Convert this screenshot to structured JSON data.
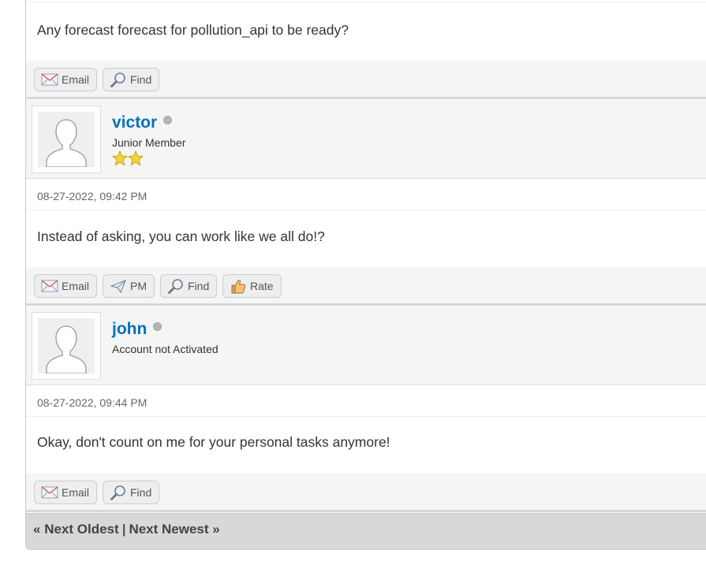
{
  "posts": [
    {
      "text": "Any forecast forecast for pollution_api to be ready?",
      "buttons": [
        {
          "label": "Email",
          "icon": "email-icon"
        },
        {
          "label": "Find",
          "icon": "magnifier-icon"
        }
      ]
    },
    {
      "username": "victor",
      "user_title": "Junior Member",
      "stars": 2,
      "date": "08-27-2022, 09:42 PM",
      "text": "Instead of asking, you can work like we all do!?",
      "buttons": [
        {
          "label": "Email",
          "icon": "email-icon"
        },
        {
          "label": "PM",
          "icon": "paper-plane-icon"
        },
        {
          "label": "Find",
          "icon": "magnifier-icon"
        },
        {
          "label": "Rate",
          "icon": "thumbs-up-icon"
        }
      ]
    },
    {
      "username": "john",
      "user_title": "Account not Activated",
      "date": "08-27-2022, 09:44 PM",
      "text": "Okay, don't count on me for your personal tasks anymore!",
      "buttons": [
        {
          "label": "Email",
          "icon": "email-icon"
        },
        {
          "label": "Find",
          "icon": "magnifier-icon"
        }
      ]
    }
  ],
  "nav": {
    "prev_arrow": "«",
    "next_oldest": "Next Oldest",
    "separator": "|",
    "next_newest": "Next Newest",
    "next_arrow": "»"
  },
  "colors": {
    "username": "#0072bc",
    "star": "#f2d43a",
    "offline": "#b5b5b5"
  }
}
